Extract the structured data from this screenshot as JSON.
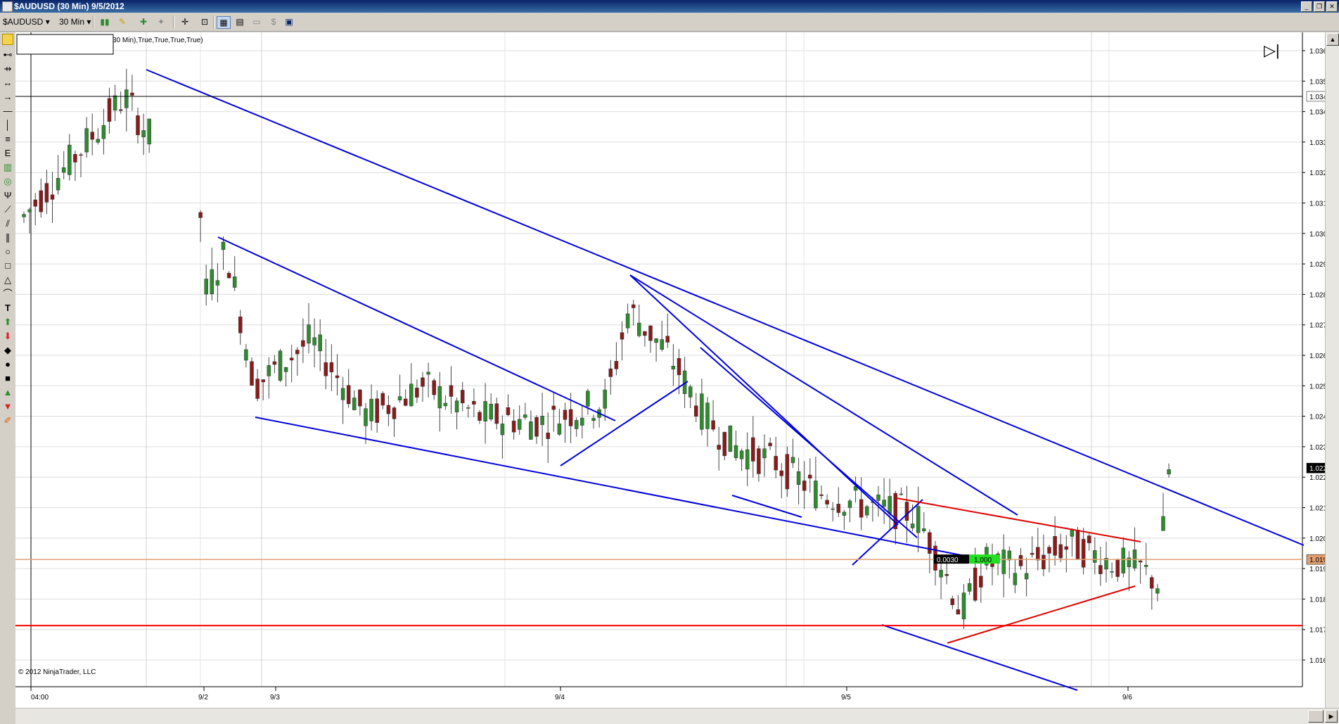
{
  "window": {
    "title": "$AUDUSD (30 Min)  9/5/2012",
    "controls": [
      "_",
      "❐",
      "✕"
    ]
  },
  "toolbar": {
    "instrument": "$AUDUSD",
    "interval": "30 Min"
  },
  "chart": {
    "indicator_label": "30 Min),True,True,True,True)",
    "copyright": "© 2012 NinjaTrader, LLC",
    "price_ticks": [
      "1.0360",
      "1.0350",
      "1.0340",
      "1.0330",
      "1.0320",
      "1.0310",
      "1.0300",
      "1.0290",
      "1.0280",
      "1.0270",
      "1.0260",
      "1.0250",
      "1.0240",
      "1.0230",
      "1.0220",
      "1.0210",
      "1.0200",
      "1.0190",
      "1.0180",
      "1.0170",
      "1.0160"
    ],
    "price_tick_values": [
      1.036,
      1.035,
      1.034,
      1.033,
      1.032,
      1.031,
      1.03,
      1.029,
      1.028,
      1.027,
      1.026,
      1.025,
      1.024,
      1.023,
      1.022,
      1.021,
      1.02,
      1.019,
      1.018,
      1.017,
      1.016
    ],
    "time_labels": [
      "04:00",
      "9/2",
      "9/3",
      "9/4",
      "9/5",
      "9/6"
    ],
    "markers": {
      "horizontal_line_price": "1.0345",
      "last_price": "1.0223",
      "crosshair_price": "1.0193",
      "measure_value": "0.0030",
      "measure_qty": "1,000"
    },
    "colors": {
      "trendline": "#0000e0",
      "support": "#ff0000",
      "bull": "#2e8b2e",
      "bear": "#8b1a1a",
      "crosshair": "#e0a070"
    }
  }
}
